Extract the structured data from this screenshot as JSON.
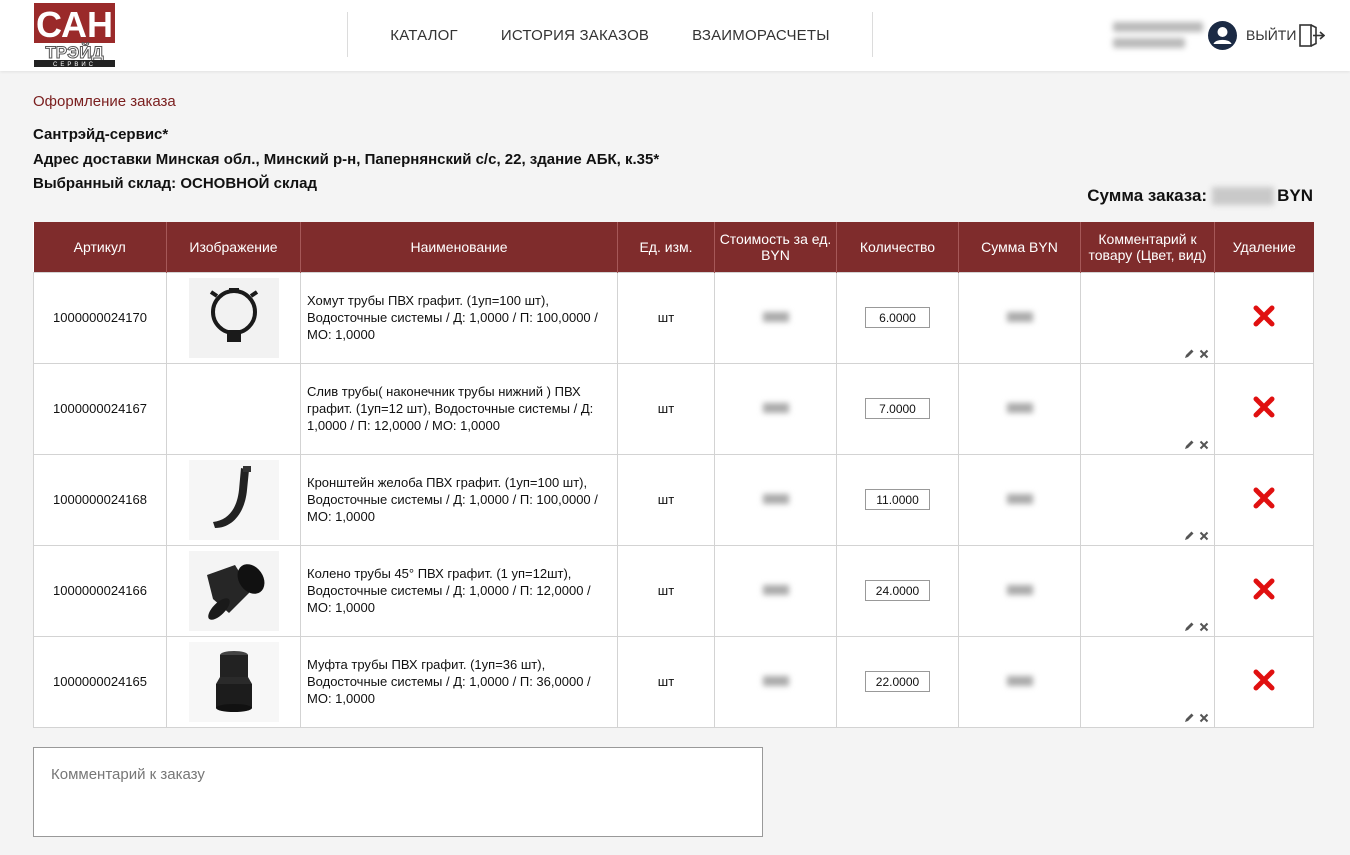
{
  "header": {
    "nav": [
      "КАТАЛОГ",
      "ИСТОРИЯ ЗАКАЗОВ",
      "ВЗАИМОРАСЧЕТЫ"
    ],
    "logout_label": "ВЫЙТИ"
  },
  "order": {
    "title": "Оформление заказа",
    "company": "Сантрэйд-сервис*",
    "address": "Адрес доставки Минская обл., Минский р-н, Папернянский с/с, 22, здание АБК, к.35*",
    "warehouse": "Выбранный склад: ОСНОВНОЙ склад",
    "sum_label": "Сумма заказа:",
    "sum_currency": "BYN"
  },
  "table": {
    "headers": [
      "Артикул",
      "Изображение",
      "Наименование",
      "Ед. изм.",
      "Стоимость за ед. BYN",
      "Количество",
      "Сумма BYN",
      "Комментарий к товару (Цвет, вид)",
      "Удаление"
    ],
    "rows": [
      {
        "article": "1000000024170",
        "image": "clamp",
        "name": "Хомут трубы ПВХ графит. (1уп=100 шт), Водосточные системы / Д: 1,0000 / П: 100,0000 / МО: 1,0000",
        "unit": "шт",
        "qty": "6.0000"
      },
      {
        "article": "1000000024167",
        "image": "",
        "name": "Слив трубы( наконечник трубы нижний ) ПВХ графит. (1уп=12 шт), Водосточные системы / Д: 1,0000 / П: 12,0000 / МО: 1,0000",
        "unit": "шт",
        "qty": "7.0000"
      },
      {
        "article": "1000000024168",
        "image": "bracket",
        "name": "Кронштейн желоба ПВХ графит. (1уп=100 шт), Водосточные системы / Д: 1,0000 / П: 100,0000 / МО: 1,0000",
        "unit": "шт",
        "qty": "11.0000"
      },
      {
        "article": "1000000024166",
        "image": "elbow",
        "name": "Колено трубы 45° ПВХ графит. (1 уп=12шт), Водосточные системы / Д: 1,0000 / П: 12,0000 / МО: 1,0000",
        "unit": "шт",
        "qty": "24.0000"
      },
      {
        "article": "1000000024165",
        "image": "coupling",
        "name": "Муфта трубы ПВХ графит. (1уп=36 шт), Водосточные системы / Д: 1,0000 / П: 36,0000 / МО: 1,0000",
        "unit": "шт",
        "qty": "22.0000"
      }
    ]
  },
  "comment": {
    "placeholder": "Комментарий к заказу"
  },
  "icons": {
    "user": "user-avatar-icon",
    "logout": "logout-door-icon",
    "edit": "pencil-icon",
    "clear": "small-x-icon",
    "delete": "red-x-icon"
  },
  "colors": {
    "header_bg": "#7f2c2c",
    "title": "#7a1e1e",
    "delete": "#e01010",
    "logo_red": "#9a2a2a"
  }
}
